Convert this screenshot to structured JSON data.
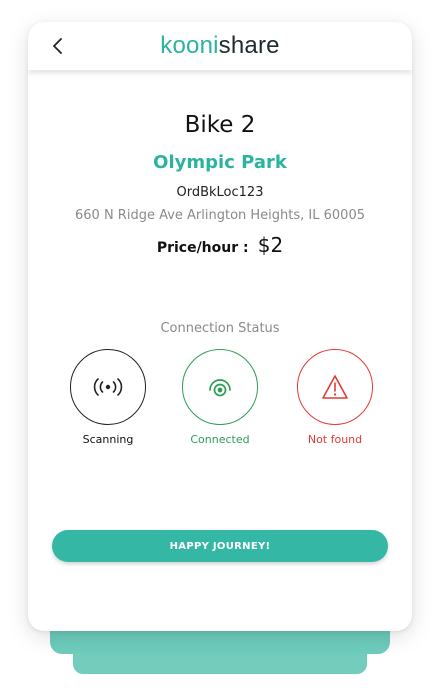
{
  "header": {
    "back_icon": "chevron-left-icon",
    "logo_part1": "kooni",
    "logo_part2": "share"
  },
  "bike": {
    "title": "Bike 2",
    "location": "Olympic Park",
    "location_code": "OrdBkLoc123",
    "address": "660 N Ridge Ave Arlington Heights, IL 60005",
    "price_label": "Price/hour :",
    "price_value": "$2"
  },
  "connection": {
    "title": "Connection Status",
    "statuses": [
      {
        "label": "Scanning",
        "icon": "broadcast-icon",
        "color": "#222222"
      },
      {
        "label": "Connected",
        "icon": "signal-connected-icon",
        "color": "#2e9e55"
      },
      {
        "label": "Not found",
        "icon": "warning-icon",
        "color": "#e53935"
      }
    ]
  },
  "actions": {
    "journey_label": "HAPPY JOURNEY!"
  },
  "colors": {
    "brand": "#2bb3a1",
    "button": "#34b8a5"
  }
}
